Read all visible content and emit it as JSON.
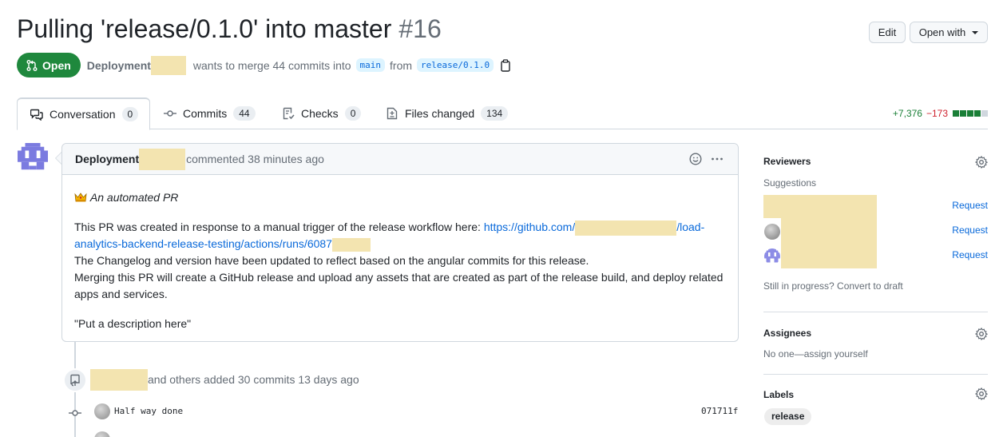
{
  "header": {
    "title": "Pulling 'release/0.1.0' into master",
    "number": "#16",
    "edit_label": "Edit",
    "open_with_label": "Open with"
  },
  "state": {
    "badge": "Open",
    "author": "Deployment",
    "merge_text": "wants to merge 44 commits into",
    "base_branch": "main",
    "from_text": "from",
    "head_branch": "release/0.1.0"
  },
  "tabs": [
    {
      "label": "Conversation",
      "count": "0",
      "icon": "comment-discussion-icon"
    },
    {
      "label": "Commits",
      "count": "44",
      "icon": "git-commit-icon"
    },
    {
      "label": "Checks",
      "count": "0",
      "icon": "checklist-icon"
    },
    {
      "label": "Files changed",
      "count": "134",
      "icon": "file-diff-icon"
    }
  ],
  "diffstat": {
    "additions": "+7,376",
    "deletions": "−173",
    "colors": {
      "add": "#1a7f37",
      "neutral": "#d0d7de"
    }
  },
  "comment": {
    "author": "Deployment",
    "meta": "commented 38 minutes ago",
    "heading": "An automated PR",
    "para1_prefix": "This PR was created in response to a manual trigger of the release workflow here: ",
    "link_part1": "https://github.com/",
    "link_part2": "/load-",
    "link_part3": "analytics-backend-release-testing/actions/runs/6087",
    "para1_line2": "The Changelog and version have been updated to reflect based on the angular commits for this release.",
    "para1_line3": "Merging this PR will create a GitHub release and upload any assets that are created as part of the release build, and deploy related apps and services.",
    "para2": "\"Put a description here\""
  },
  "timeline": {
    "event_text": "and others added 30 commits 13 days ago",
    "commits": [
      {
        "message": "Half way done",
        "sha": "071711f"
      }
    ]
  },
  "sidebar": {
    "reviewers": {
      "title": "Reviewers",
      "suggestions_label": "Suggestions",
      "request_label": "Request",
      "draft_text": "Still in progress? Convert to draft"
    },
    "assignees": {
      "title": "Assignees",
      "value": "No one—assign yourself"
    },
    "labels": {
      "title": "Labels",
      "items": [
        "release"
      ]
    }
  },
  "colors": {
    "open_green": "#1f883d",
    "link_blue": "#0969da",
    "redaction": "#f3e4b0"
  }
}
